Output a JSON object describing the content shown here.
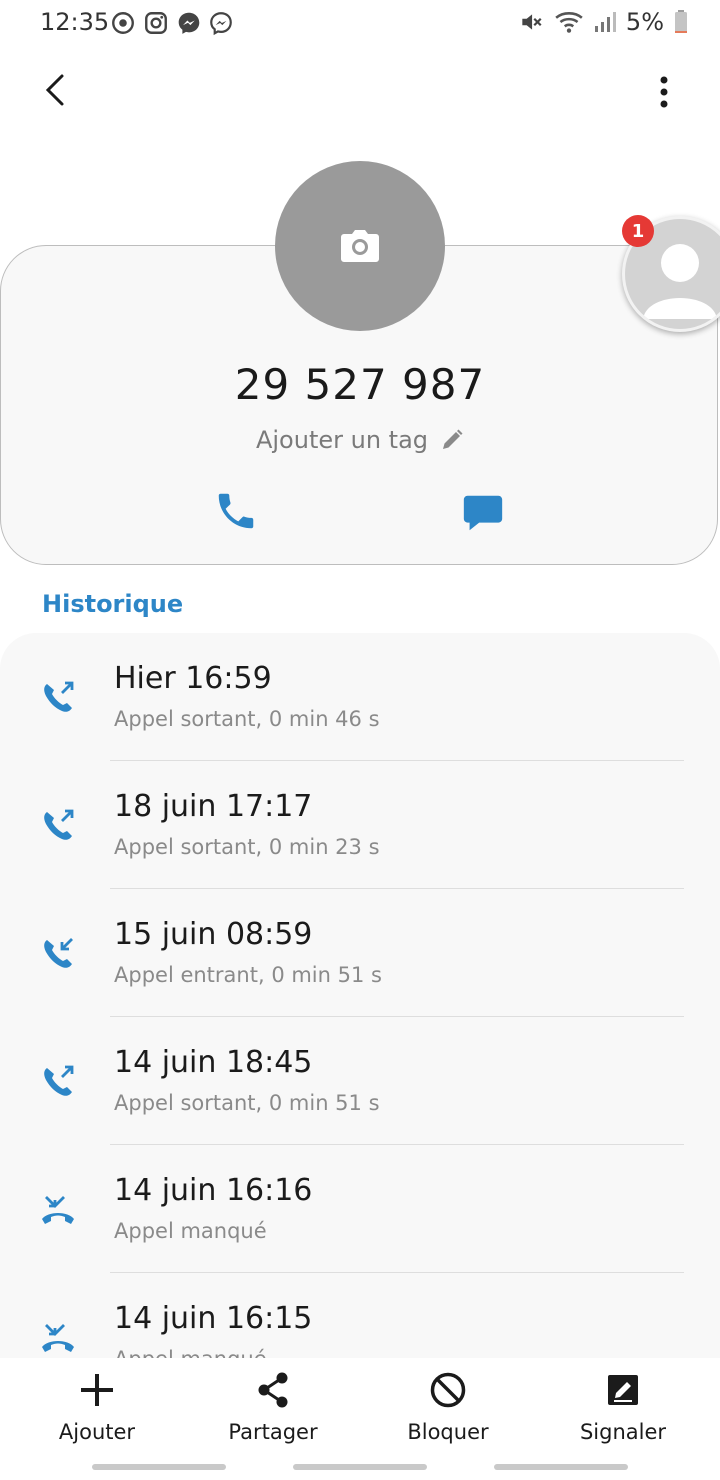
{
  "status_bar": {
    "time": "12:35",
    "left_icons": [
      "sync-icon",
      "instagram-icon",
      "messenger-icon",
      "messenger-outline-icon"
    ],
    "right_icons": [
      "mute-icon",
      "wifi-icon",
      "signal-icon",
      "battery-icon"
    ],
    "battery": "5%",
    "battery_level": 0.05
  },
  "app_bar": {
    "back_icon": "chevron-left-icon",
    "more_icon": "more-vertical-icon"
  },
  "contact": {
    "avatar_icon": "camera-icon",
    "number": "29 527 987",
    "tag_placeholder": "Ajouter un tag",
    "tag_icon": "pencil-icon",
    "actions": [
      "phone-icon",
      "message-icon"
    ],
    "accent": "#2d86c7"
  },
  "bubble": {
    "badge": "1"
  },
  "history": {
    "title": "Historique",
    "entries": [
      {
        "date": "Hier 16:59",
        "desc": "Appel sortant, 0 min 46 s",
        "type": "outgoing"
      },
      {
        "date": "18 juin 17:17",
        "desc": "Appel sortant, 0 min 23 s",
        "type": "outgoing"
      },
      {
        "date": "15 juin 08:59",
        "desc": "Appel entrant, 0 min 51 s",
        "type": "incoming"
      },
      {
        "date": "14 juin 18:45",
        "desc": "Appel sortant, 0 min 51 s",
        "type": "outgoing"
      },
      {
        "date": "14 juin 16:16",
        "desc": "Appel manqué",
        "type": "missed"
      },
      {
        "date": "14 juin 16:15",
        "desc": "Appel manqué",
        "type": "missed"
      }
    ]
  },
  "bottom_bar": {
    "items": [
      {
        "label": "Ajouter",
        "icon": "plus-icon"
      },
      {
        "label": "Partager",
        "icon": "share-icon"
      },
      {
        "label": "Bloquer",
        "icon": "block-icon"
      },
      {
        "label": "Signaler",
        "icon": "report-icon"
      }
    ]
  }
}
